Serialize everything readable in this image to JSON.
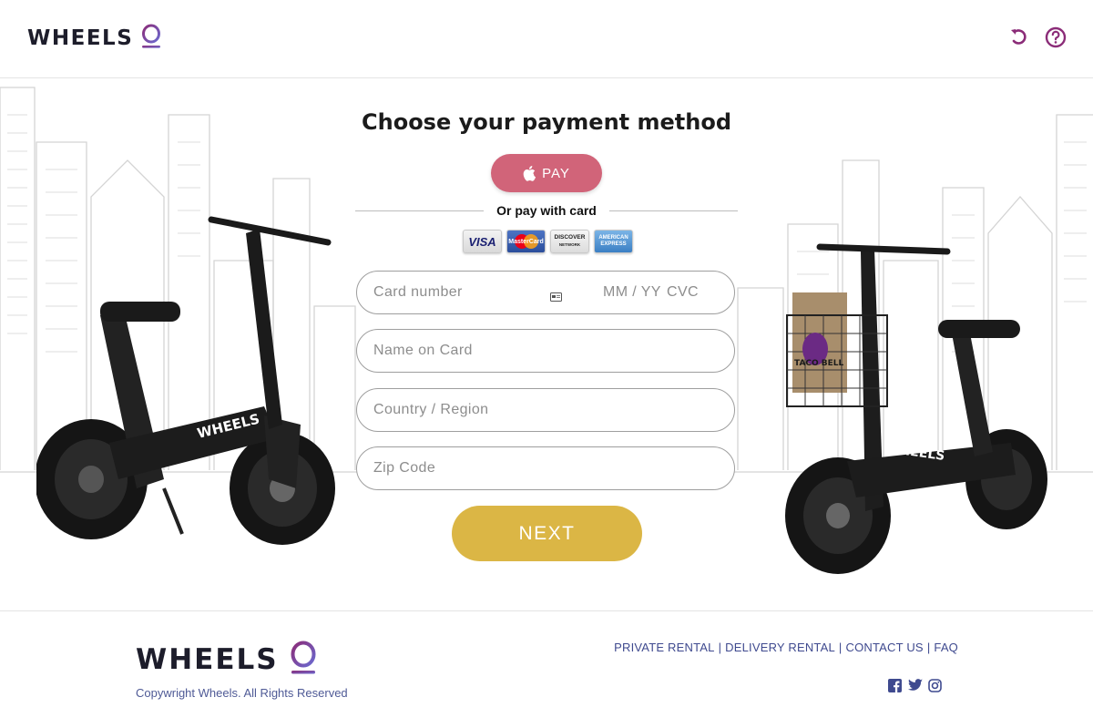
{
  "brand": {
    "name": "WHEELS",
    "accent": "#8b2c78",
    "accent_light": "#6b6ad0"
  },
  "header": {
    "icons": [
      "undo-icon",
      "help-icon"
    ]
  },
  "main": {
    "title": "Choose your payment method",
    "apple_pay_label": "PAY",
    "divider_text": "Or pay with card",
    "card_brands": {
      "visa": "VISA",
      "mastercard": "MasterCard",
      "discover_top": "DISCOVER",
      "discover_bottom": "NETWORK",
      "amex_top": "AMERICAN",
      "amex_bottom": "EXPRESS"
    },
    "fields": {
      "card_number": {
        "placeholder": "Card number",
        "value": ""
      },
      "expiry": {
        "placeholder": "MM / YY"
      },
      "cvc": {
        "placeholder": "CVC"
      },
      "name": {
        "placeholder": "Name on Card",
        "value": ""
      },
      "country": {
        "placeholder": "Country / Region",
        "value": ""
      },
      "zip": {
        "placeholder": "Zip Code",
        "value": ""
      }
    },
    "next_label": "NEXT",
    "scooter_left_label": "WHEELS",
    "scooter_right_label": "WHEELS",
    "basket_label": "TACO BELL"
  },
  "colors": {
    "apple_pay_bg": "#d16479",
    "next_bg": "#dbb645",
    "link_color": "#3f4a8f"
  },
  "footer": {
    "brand": "WHEELS",
    "copyright": "Copywright Wheels. All Rights Reserved",
    "links": [
      "PRIVATE RENTAL",
      "DELIVERY RENTAL",
      "CONTACT US",
      "FAQ"
    ],
    "social": [
      "facebook-icon",
      "twitter-icon",
      "instagram-icon"
    ]
  }
}
